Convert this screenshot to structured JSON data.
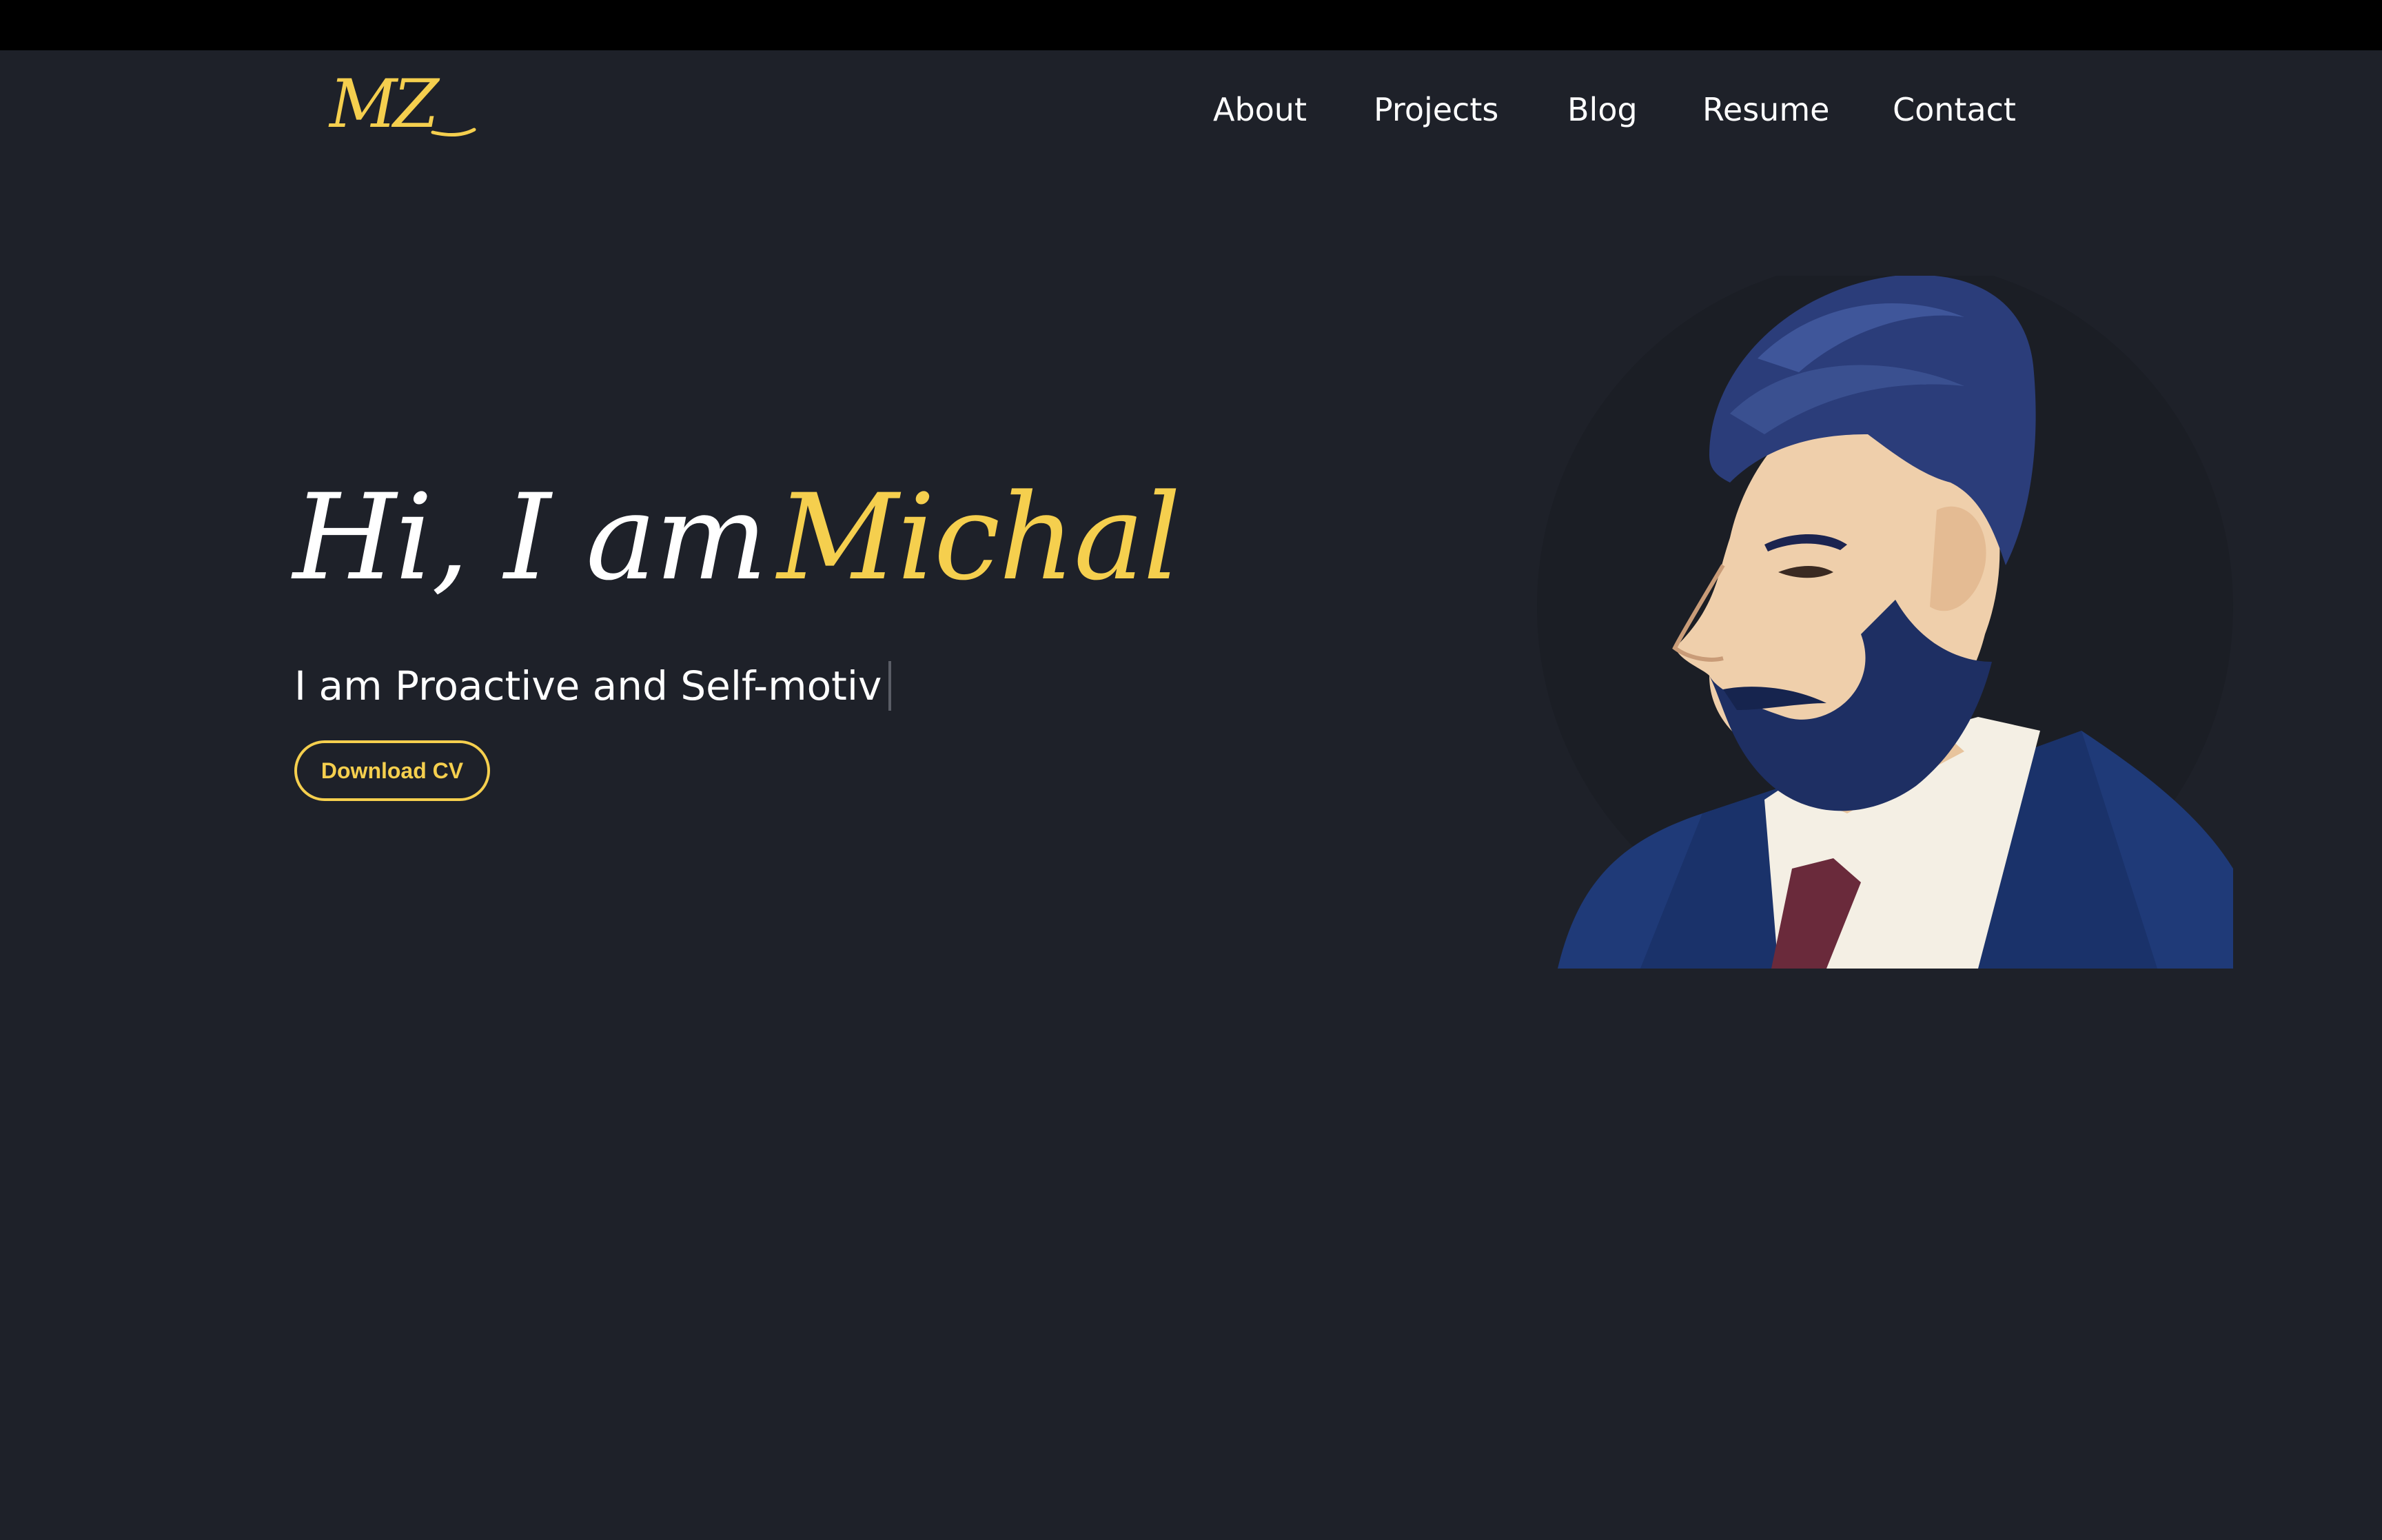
{
  "logo": {
    "text": "MZ",
    "color": "#f5cf4e"
  },
  "nav": {
    "items": [
      {
        "label": "About"
      },
      {
        "label": "Projects"
      },
      {
        "label": "Blog"
      },
      {
        "label": "Resume"
      },
      {
        "label": "Contact"
      }
    ]
  },
  "hero": {
    "greeting_prefix": "Hi, I am",
    "greeting_name": "Michal",
    "subtitle": "I am Proactive and Self-motiv",
    "download_button": "Download CV",
    "portrait_icon": "bearded-man-portrait"
  },
  "colors": {
    "background": "#1e2129",
    "accent": "#f5cf4e",
    "text": "#ffffff",
    "topbar": "#000000"
  }
}
